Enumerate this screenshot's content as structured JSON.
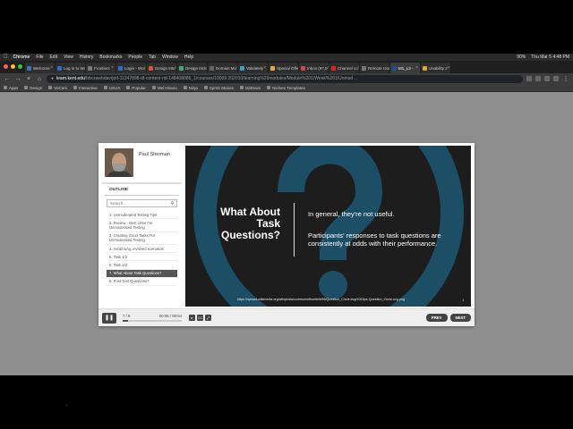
{
  "menubar": {
    "app": "Chrome",
    "items": [
      "File",
      "Edit",
      "View",
      "History",
      "Bookmarks",
      "People",
      "Tab",
      "Window",
      "Help"
    ],
    "battery": "90%",
    "clock": "Thu Mar 5  4:48 PM"
  },
  "tabs": [
    {
      "label": "Welcome",
      "color": "#3b74c7"
    },
    {
      "label": "Log in to Wo",
      "color": "#2a6bd6"
    },
    {
      "label": "Frontiers",
      "color": "#777"
    },
    {
      "label": "Login - Wor",
      "color": "#2a6bd6"
    },
    {
      "label": "Design Inte",
      "color": "#e24a3b"
    },
    {
      "label": "Design tricks",
      "color": "#3fa77a"
    },
    {
      "label": "Domain Mo",
      "color": "#666"
    },
    {
      "label": "Validately",
      "color": "#3aa0c9"
    },
    {
      "label": "Special Offe",
      "color": "#e8a93b"
    },
    {
      "label": "Inbox (97,0",
      "color": "#d44638"
    },
    {
      "label": "Channel co",
      "color": "#e62117"
    },
    {
      "label": "Remote Usa",
      "color": "#777"
    },
    {
      "label": "M1_L3 -",
      "color": "#1d4f9c",
      "active": true
    },
    {
      "label": "Usability 2",
      "color": "#e2a52b"
    }
  ],
  "url": {
    "host": "learn.kent.edu",
    "path": "/bbcswebdav/pid-11247898-dt-content-rid-148408086_1/courses/10009.202010/learning%20modules/Module%201/Week%201/Unmod…"
  },
  "bookmarks": [
    "Apps",
    "Design",
    "VoCam",
    "Interactive",
    "UXUX",
    "Popular",
    "Mel Hirano",
    "Ninja",
    "Sprint Stories",
    "GitDown",
    "Nielsen Templates"
  ],
  "sidebar": {
    "presenter": "Paul Sherman",
    "outline_heading": "OUTLINE",
    "search_placeholder": "Search...",
    "search_icon": "search-icon",
    "items": [
      {
        "label": "1. Unmoderated Testing Tips"
      },
      {
        "label": "2. Review - Best Uses For Unmoderated Testing"
      },
      {
        "label": "3. Creating Good Tasks For Unmoderated Testing"
      },
      {
        "label": "4. Avoid long, involved scenarios"
      },
      {
        "label": "5. Task 1/2"
      },
      {
        "label": "6. Task 2/2"
      },
      {
        "label": "7. What About Task Questions?",
        "active": true
      },
      {
        "label": "8. Post-Test Questions?"
      }
    ]
  },
  "slide": {
    "title": "What About Task Questions?",
    "text1": "In general, they're not useful.",
    "text2": "Participants' responses to task questions are consistently at odds with their performance.",
    "credit": "https://upload.wikimedia.org/wikipedia/commons/thumb/6/96/Question_Circle.svg/1024px-Question_Circle.svg.png",
    "number": "1",
    "colors": {
      "ring": "#1c4e66",
      "dark": "#1d1d1d"
    }
  },
  "controls": {
    "page_count": "7 / 8",
    "time": "00:05 / 00:54",
    "progress": 0.09,
    "pause_icon": "pause-icon",
    "cc_label": "CC",
    "prev_label": "PREV",
    "next_label": "NEXT"
  }
}
